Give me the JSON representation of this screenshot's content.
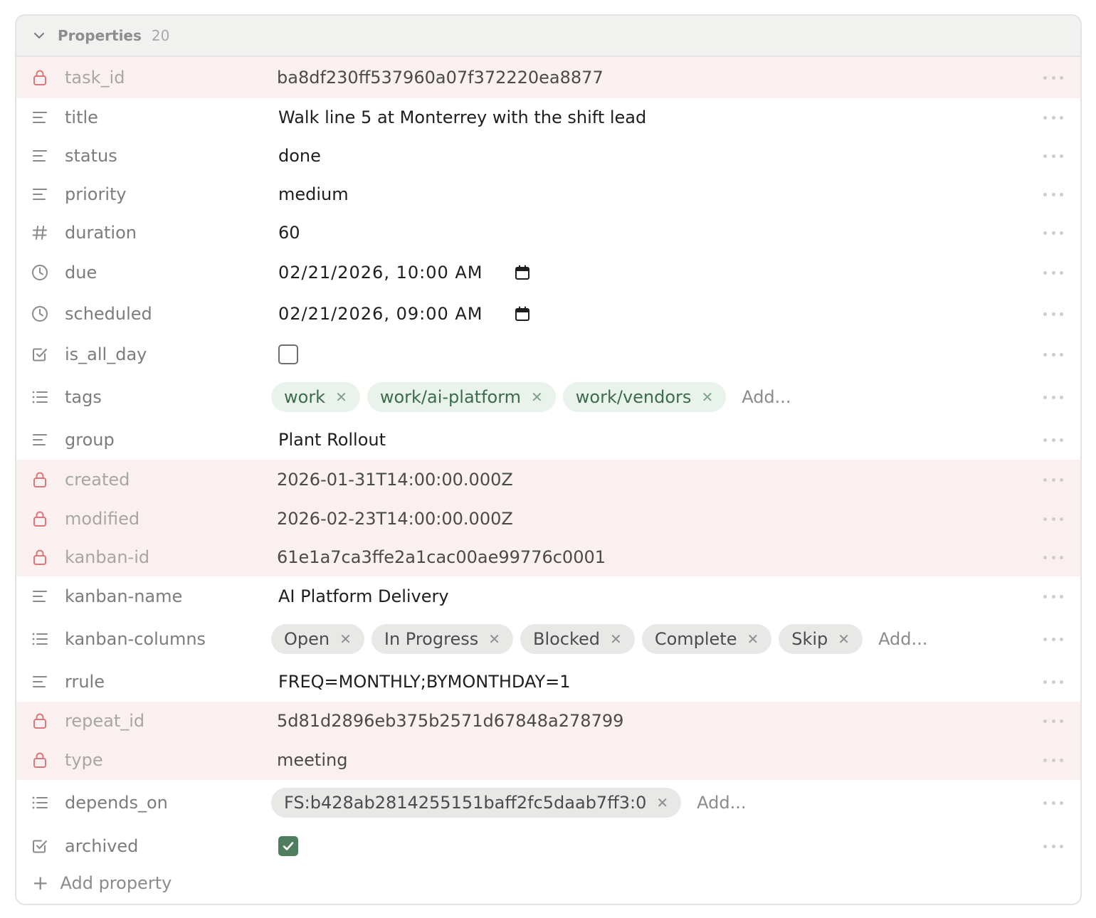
{
  "header": {
    "title": "Properties",
    "count": "20"
  },
  "rows": [
    {
      "key": "task_id",
      "value": "ba8df230ff537960a07f372220ea8877"
    },
    {
      "key": "title",
      "value": "Walk line 5 at Monterrey with the shift lead"
    },
    {
      "key": "status",
      "value": "done"
    },
    {
      "key": "priority",
      "value": "medium"
    },
    {
      "key": "duration",
      "value": "60"
    },
    {
      "key": "due",
      "value": "02/21/2026, 10:00 AM"
    },
    {
      "key": "scheduled",
      "value": "02/21/2026, 09:00 AM"
    },
    {
      "key": "is_all_day",
      "checked": false
    },
    {
      "key": "tags",
      "chips": [
        "work",
        "work/ai-platform",
        "work/vendors"
      ],
      "add_label": "Add..."
    },
    {
      "key": "group",
      "value": "Plant Rollout"
    },
    {
      "key": "created",
      "value": "2026-01-31T14:00:00.000Z"
    },
    {
      "key": "modified",
      "value": "2026-02-23T14:00:00.000Z"
    },
    {
      "key": "kanban-id",
      "value": "61e1a7ca3ffe2a1cac00ae99776c0001"
    },
    {
      "key": "kanban-name",
      "value": "AI Platform Delivery"
    },
    {
      "key": "kanban-columns",
      "chips": [
        "Open",
        "In Progress",
        "Blocked",
        "Complete",
        "Skip"
      ],
      "add_label": "Add..."
    },
    {
      "key": "rrule",
      "value": "FREQ=MONTHLY;BYMONTHDAY=1"
    },
    {
      "key": "repeat_id",
      "value": "5d81d2896eb375b2571d67848a278799"
    },
    {
      "key": "type",
      "value": "meeting"
    },
    {
      "key": "depends_on",
      "chips": [
        "FS:b428ab2814255151baff2fc5daab7ff3:0"
      ],
      "add_label": "Add..."
    },
    {
      "key": "archived",
      "checked": true
    }
  ],
  "footer": {
    "add_property_label": "Add property"
  },
  "icons": {
    "locked": "lock-icon",
    "text": "text-lines-icon",
    "number": "hash-icon",
    "datetime": "clock-icon",
    "checkbox": "checkbox-icon",
    "list": "list-icon"
  },
  "colors": {
    "locked_row_bg": "#fbf0f0",
    "lock_icon": "#d9767b",
    "green_chip_bg": "#e9f3ec",
    "green_chip_text": "#3c6b4c",
    "gray_chip_bg": "#e8e8e6",
    "checkbox_checked": "#4f7d5e"
  }
}
